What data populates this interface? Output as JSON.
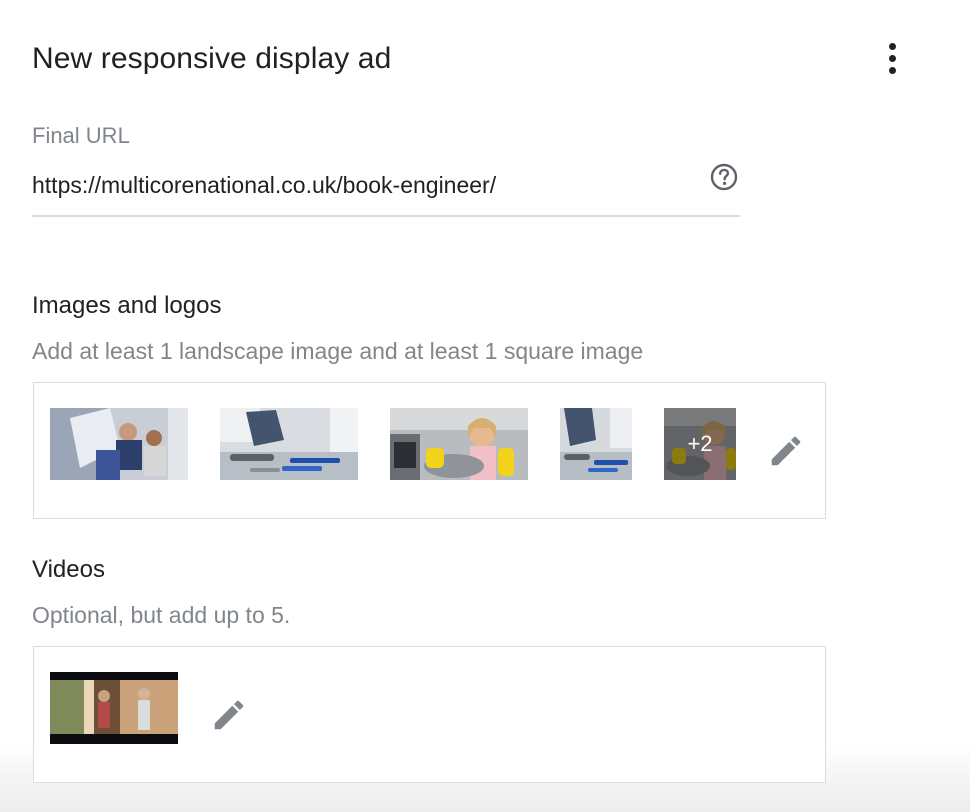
{
  "header": {
    "title": "New responsive display ad",
    "more_icon": "more-vert-icon"
  },
  "final_url": {
    "label": "Final URL",
    "value": "https://multicorenational.co.uk/book-engineer/",
    "help_icon": "help-circle-icon"
  },
  "images_section": {
    "title": "Images and logos",
    "hint": "Add at least 1 landscape image and at least 1 square image",
    "thumbnails": [
      {
        "name": "technicians-repairing-appliance",
        "shape": "landscape"
      },
      {
        "name": "plumbing-tools-on-floor",
        "shape": "landscape"
      },
      {
        "name": "surprised-woman-kitchen",
        "shape": "landscape"
      },
      {
        "name": "plumbing-tools-square",
        "shape": "square"
      },
      {
        "name": "woman-kitchen-square",
        "shape": "square"
      }
    ],
    "more_count": "+2",
    "edit_icon": "pencil-icon"
  },
  "videos_section": {
    "title": "Videos",
    "hint": "Optional, but add up to 5.",
    "thumbnails": [
      {
        "name": "couple-in-room-video",
        "shape": "landscape"
      }
    ],
    "edit_icon": "pencil-icon"
  }
}
